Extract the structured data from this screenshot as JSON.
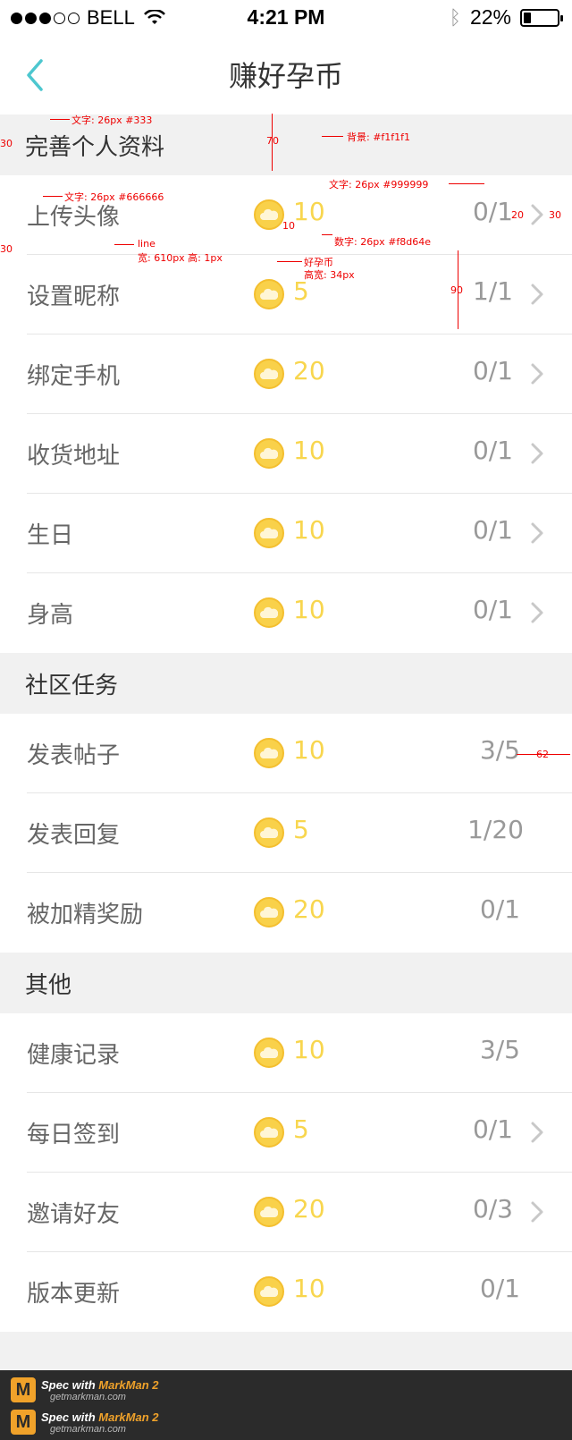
{
  "status_bar": {
    "carrier": "BELL",
    "time": "4:21 PM",
    "battery": "22%",
    "battery_level": 0.22
  },
  "nav": {
    "title": "赚好孕币",
    "back_icon": "chevron-left-icon"
  },
  "sections": [
    {
      "title": "完善个人资料",
      "rows": [
        {
          "label": "上传头像",
          "reward": "10",
          "progress": "0/1",
          "arrow": true
        },
        {
          "label": "设置昵称",
          "reward": "5",
          "progress": "1/1",
          "arrow": true
        },
        {
          "label": "绑定手机",
          "reward": "20",
          "progress": "0/1",
          "arrow": true
        },
        {
          "label": "收货地址",
          "reward": "10",
          "progress": "0/1",
          "arrow": true
        },
        {
          "label": "生日",
          "reward": "10",
          "progress": "0/1",
          "arrow": true
        },
        {
          "label": "身高",
          "reward": "10",
          "progress": "0/1",
          "arrow": true
        }
      ]
    },
    {
      "title": "社区任务",
      "rows": [
        {
          "label": "发表帖子",
          "reward": "10",
          "progress": "3/5",
          "arrow": false
        },
        {
          "label": "发表回复",
          "reward": "5",
          "progress": "1/20",
          "arrow": false
        },
        {
          "label": "被加精奖励",
          "reward": "20",
          "progress": "0/1",
          "arrow": false
        }
      ]
    },
    {
      "title": "其他",
      "rows": [
        {
          "label": "健康记录",
          "reward": "10",
          "progress": "3/5",
          "arrow": false
        },
        {
          "label": "每日签到",
          "reward": "5",
          "progress": "0/1",
          "arrow": true
        },
        {
          "label": "邀请好友",
          "reward": "20",
          "progress": "0/3",
          "arrow": true
        },
        {
          "label": "版本更新",
          "reward": "10",
          "progress": "0/1",
          "arrow": false
        }
      ]
    }
  ],
  "annotations": {
    "a1": "文字: 26px #333",
    "a2": "70",
    "a3": "背景: #f1f1f1",
    "a4": "30",
    "a5": "文字: 26px #666666",
    "a6": "文字: 26px #999999",
    "a7": "20",
    "a8": "30",
    "a9": "10",
    "a10": "数字: 26px #f8d64e",
    "a11": "30",
    "a12": "line",
    "a13": "宽: 610px 高: 1px",
    "a14": "好孕币",
    "a15": "高宽: 34px",
    "a16": "90",
    "a17": "62"
  },
  "footer": {
    "brand_prefix": "Spec with ",
    "brand_name": "MarkMan 2",
    "url": "getmarkman.com"
  },
  "colors": {
    "background": "#f1f1f1",
    "accent": "#4dc7cf",
    "coin": "#f8d64e",
    "label": "#666666",
    "progress": "#999999",
    "annotation": "#e00000"
  }
}
